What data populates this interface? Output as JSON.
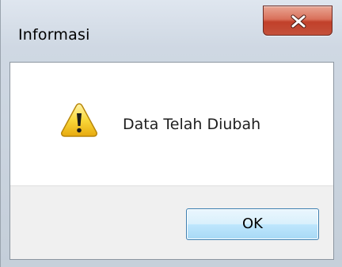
{
  "window": {
    "title": "Informasi",
    "close_icon": "close-icon"
  },
  "dialog": {
    "icon": "warning-icon",
    "message": "Data Telah Diubah",
    "ok_label": "OK"
  },
  "colors": {
    "close_button": "#c94b35",
    "ok_border": "#3c7fb1",
    "warning_yellow": "#f7d21c"
  }
}
